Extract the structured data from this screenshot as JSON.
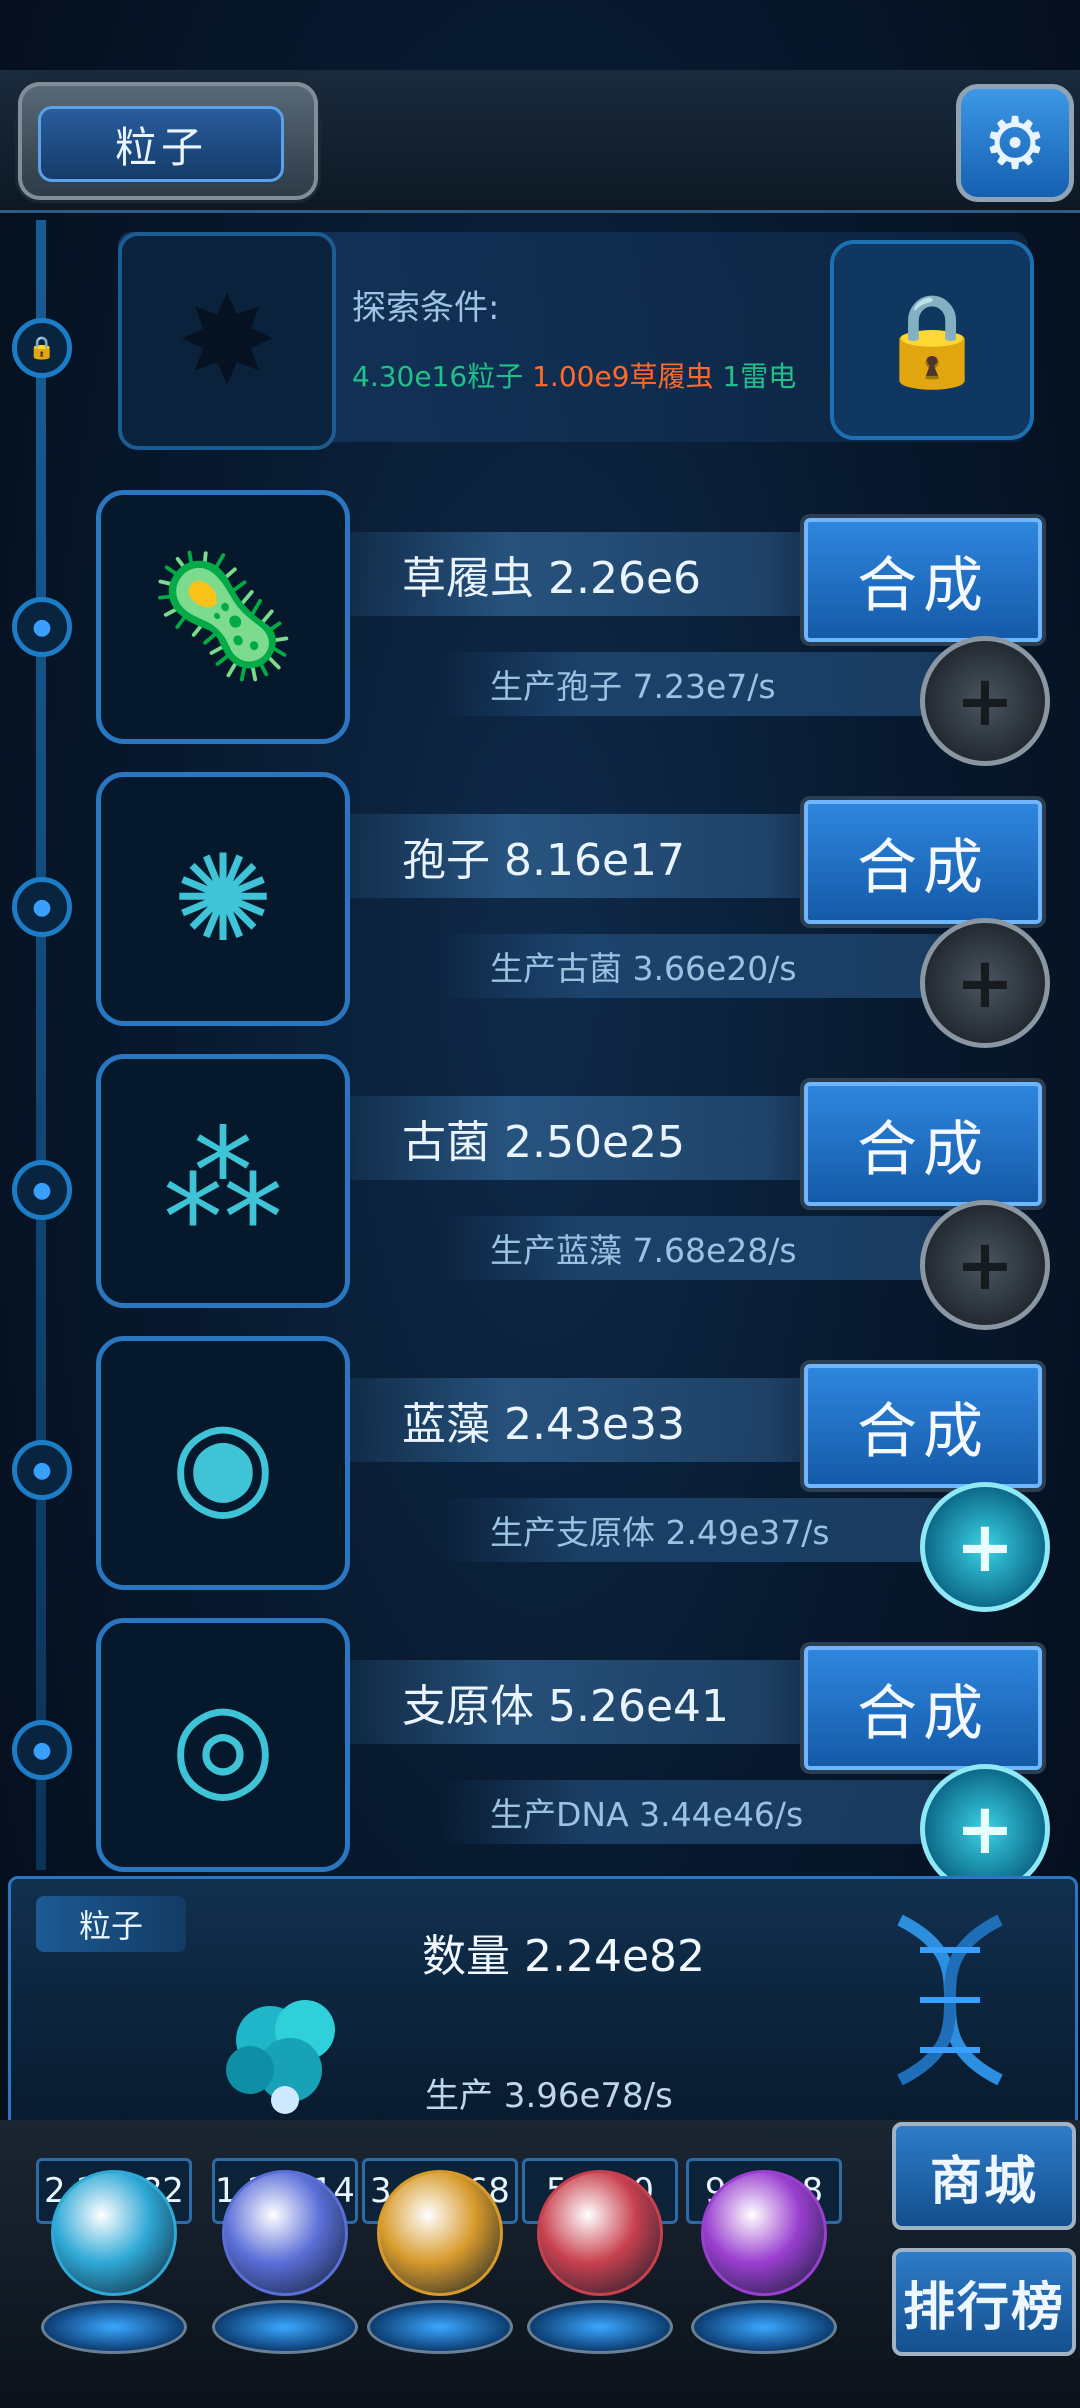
{
  "header": {
    "title": "粒子",
    "settings_icon": "gear-icon"
  },
  "explore": {
    "label": "探索条件:",
    "conditions": [
      {
        "text": "4.30e16粒子",
        "color": "#21c08b"
      },
      {
        "text": "1.00e9草履虫",
        "color": "#ff6a2b"
      },
      {
        "text": "1雷电",
        "color": "#21c08b"
      }
    ],
    "lock_icon": "lock-icon"
  },
  "items": [
    {
      "name": "草履虫 2.26e6",
      "production": "生产孢子 7.23e7/s",
      "synth_label": "合成",
      "plus_style": "dark",
      "icon": "paramecium-icon"
    },
    {
      "name": "孢子 8.16e17",
      "production": "生产古菌 3.66e20/s",
      "synth_label": "合成",
      "plus_style": "dark",
      "icon": "spore-icon"
    },
    {
      "name": "古菌 2.50e25",
      "production": "生产蓝藻 7.68e28/s",
      "synth_label": "合成",
      "plus_style": "dark",
      "icon": "archaea-icon"
    },
    {
      "name": "蓝藻 2.43e33",
      "production": "生产支原体 2.49e37/s",
      "synth_label": "合成",
      "plus_style": "cyan",
      "icon": "cyanobacteria-icon"
    },
    {
      "name": "支原体 5.26e41",
      "production": "生产DNA 3.44e46/s",
      "synth_label": "合成",
      "plus_style": "cyan",
      "icon": "mycoplasma-icon"
    }
  ],
  "panel": {
    "tag": "粒子",
    "count": "数量 2.24e82",
    "production": "生产 3.96e78/s"
  },
  "resources": [
    {
      "value": "2.24e82",
      "orb_color": "#2fa9d6",
      "icon": "particle-orb-icon"
    },
    {
      "value": "1.26e14",
      "orb_color": "#5b6fd8",
      "icon": "lightning-orb-icon"
    },
    {
      "value": "3.62e68",
      "orb_color": "#d79a2b",
      "icon": "fire-orb-icon"
    },
    {
      "value": "52600",
      "orb_color": "#c9414f",
      "icon": "brain-orb-icon"
    },
    {
      "value": "9.56e8",
      "orb_color": "#9a3fd0",
      "icon": "vortex-orb-icon"
    }
  ],
  "side_buttons": {
    "shop": "商城",
    "rank": "排行榜"
  }
}
